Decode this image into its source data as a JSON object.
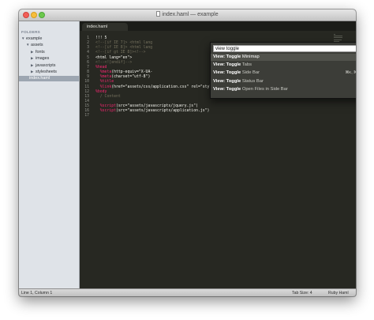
{
  "window": {
    "title": "index.haml — example"
  },
  "sidebar": {
    "header": "FOLDERS",
    "tree": [
      {
        "label": "example",
        "arrow": "▼",
        "indent": 3
      },
      {
        "label": "assets",
        "arrow": "▼",
        "indent": 9
      },
      {
        "label": "fonts",
        "arrow": "▶",
        "indent": 15
      },
      {
        "label": "images",
        "arrow": "▶",
        "indent": 15
      },
      {
        "label": "javascripts",
        "arrow": "▶",
        "indent": 15
      },
      {
        "label": "stylesheets",
        "arrow": "▶",
        "indent": 15
      },
      {
        "label": "index.haml",
        "arrow": "",
        "indent": 13,
        "selected": true
      }
    ]
  },
  "tab": {
    "label": "index.haml"
  },
  "code_lines": [
    [
      {
        "t": "!!! 5",
        "c": ""
      }
    ],
    [
      {
        "t": "<!--[if IE 7]> <html lang",
        "c": "c-com"
      }
    ],
    [
      {
        "t": "<!--[if IE 8]> <html lang",
        "c": "c-com"
      }
    ],
    [
      {
        "t": "<!--[if gt IE 8]><!-->",
        "c": "c-com"
      }
    ],
    [
      {
        "t": "<html lang=\"en\">",
        "c": ""
      }
    ],
    [
      {
        "t": "<!--<![endif]-->",
        "c": "c-com"
      }
    ],
    [
      {
        "t": "%head",
        "c": "c-tag"
      }
    ],
    [
      {
        "t": "  ",
        "c": ""
      },
      {
        "t": "%meta",
        "c": "c-tag"
      },
      {
        "t": "(http-equiv=\"X-UA-",
        "c": ""
      }
    ],
    [
      {
        "t": "  ",
        "c": ""
      },
      {
        "t": "%meta",
        "c": "c-tag"
      },
      {
        "t": "(charset=\"utf-8\")",
        "c": ""
      }
    ],
    [
      {
        "t": "  ",
        "c": ""
      },
      {
        "t": "%title",
        "c": "c-tag"
      }
    ],
    [
      {
        "t": "  ",
        "c": ""
      },
      {
        "t": "%link",
        "c": "c-tag"
      },
      {
        "t": "(href=\"assets/css/application.css\" rel=\"stylesheet\")",
        "c": ""
      }
    ],
    [
      {
        "t": "%body",
        "c": "c-tag"
      }
    ],
    [
      {
        "t": "  / Content",
        "c": "c-com"
      }
    ],
    [
      {
        "t": "",
        "c": ""
      }
    ],
    [
      {
        "t": "  ",
        "c": ""
      },
      {
        "t": "%script",
        "c": "c-tag"
      },
      {
        "t": "(src=\"assets/javascripts/jquery.js\")",
        "c": ""
      }
    ],
    [
      {
        "t": "  ",
        "c": ""
      },
      {
        "t": "%script",
        "c": "c-tag"
      },
      {
        "t": "(src=\"assets/javascripts/application.js\")",
        "c": ""
      }
    ],
    [
      {
        "t": "",
        "c": ""
      }
    ]
  ],
  "palette": {
    "input_value": "view toggle",
    "items": [
      {
        "prefix": "View: Toggle",
        "rest": " Minimap",
        "shortcut": "",
        "selected": true
      },
      {
        "prefix": "View: Toggle",
        "rest": " Tabs",
        "shortcut": ""
      },
      {
        "prefix": "View: Toggle",
        "rest": " Side Bar",
        "shortcut": "⌘K, ⌘B"
      },
      {
        "prefix": "View: Toggle",
        "rest": " Status Bar",
        "shortcut": ""
      },
      {
        "prefix": "View: Toggle",
        "rest": " Open Files in Side Bar",
        "shortcut": ""
      }
    ]
  },
  "status": {
    "position": "Line 1, Column 1",
    "tab_size": "Tab Size: 4",
    "syntax": "Ruby Haml"
  }
}
